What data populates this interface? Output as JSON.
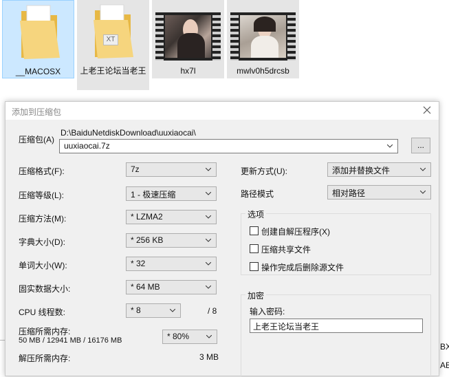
{
  "files": [
    {
      "label": "__MACOSX",
      "kind": "folder",
      "state": "selected"
    },
    {
      "label": "上老王论坛当老王",
      "kind": "folder-txt",
      "state": "hover",
      "badge": "XT"
    },
    {
      "label": "hx7l",
      "kind": "video",
      "state": "hover"
    },
    {
      "label": "mwlv0h5drcsb",
      "kind": "video",
      "state": "hover"
    }
  ],
  "dialog": {
    "title": "添加到压缩包",
    "archive": {
      "label": "压缩包(A)",
      "path": "D:\\BaiduNetdiskDownload\\uuxiaocai\\",
      "name": "uuxiaocai.7z",
      "browse_label": "..."
    },
    "left": {
      "format": {
        "label": "压缩格式(F):",
        "value": "7z"
      },
      "level": {
        "label": "压缩等级(L):",
        "value": "1 - 极速压缩"
      },
      "method": {
        "label": "压缩方法(M):",
        "value": "* LZMA2"
      },
      "dict": {
        "label": "字典大小(D):",
        "value": "* 256 KB"
      },
      "word": {
        "label": "单词大小(W):",
        "value": "* 32"
      },
      "solid": {
        "label": "固实数据大小:",
        "value": "* 64 MB"
      },
      "cpu": {
        "label": "CPU 线程数:",
        "value": "* 8",
        "total": "/ 8"
      },
      "mem_compress": {
        "label": "压缩所需内存:",
        "detail": "50 MB / 12941 MB / 16176 MB",
        "value": "* 80%"
      },
      "mem_decompress": {
        "label": "解压所需内存:",
        "value": "3 MB"
      }
    },
    "right": {
      "update": {
        "label": "更新方式(U):",
        "value": "添加并替换文件"
      },
      "pathmode": {
        "label": "路径模式",
        "value": "相对路径"
      },
      "options": {
        "title": "选项",
        "items": [
          "创建自解压程序(X)",
          "压缩共享文件",
          "操作完成后删除源文件"
        ]
      },
      "encrypt": {
        "title": "加密",
        "password_label": "输入密码:",
        "password_value": "上老王论坛当老王"
      }
    }
  },
  "background_edge": {
    "text_bx": "BX",
    "text_ab": "AB"
  },
  "colors": {
    "selection": "#cce8ff",
    "hover": "#e5e5e5",
    "folder": "#f4d37a",
    "dialog_bg": "#f0f0f0"
  },
  "icons": {
    "close": "close-icon",
    "dropdown": "chevron-down-icon",
    "folder": "folder-icon",
    "video": "video-file-icon"
  }
}
